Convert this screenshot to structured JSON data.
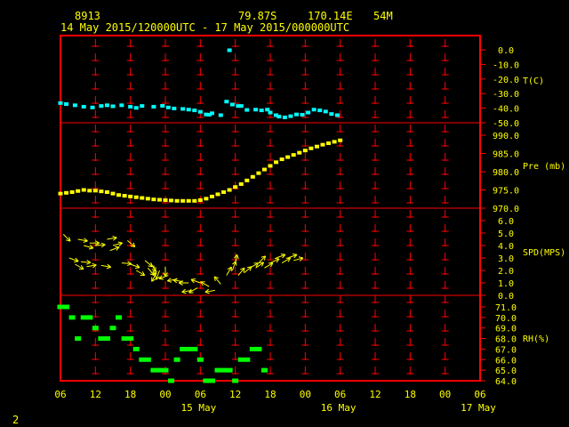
{
  "header": {
    "station_id": "8913",
    "lat": "79.87S",
    "lon": "170.14E",
    "elev": "54M",
    "time_range": "14 May 2015/120000UTC - 17 May 2015/000000UTC"
  },
  "footer": {
    "page_number": "2"
  },
  "colors": {
    "frame": "#ff0000",
    "ticks": "#ff0000",
    "labels": "#ffff00",
    "temperature": "#00ffff",
    "pressure": "#ffff00",
    "wind": "#ffff00",
    "rh": "#00ff00"
  },
  "chart_data": {
    "type": "scatter",
    "x_axis": {
      "range_hours": [
        0,
        72
      ],
      "tick_labels": [
        "06",
        "12",
        "18",
        "00",
        "06",
        "12",
        "18",
        "00",
        "06",
        "12",
        "18",
        "00",
        "06"
      ],
      "day_labels": [
        {
          "label": "15 May",
          "hour": 24
        },
        {
          "label": "16 May",
          "hour": 48
        },
        {
          "label": "17 May",
          "hour": 72
        }
      ]
    },
    "panels": [
      {
        "name": "T(C)",
        "series": "temperature",
        "ylim": [
          -50,
          0
        ],
        "ticks": [
          "0.0",
          "-10.0",
          "-20.0",
          "-30.0",
          "-40.0",
          "-50.0"
        ],
        "points": [
          [
            0.0,
            -36.5
          ],
          [
            1.0,
            -37.2
          ],
          [
            2.5,
            -38.0
          ],
          [
            4.0,
            -39.0
          ],
          [
            5.5,
            -39.5
          ],
          [
            7.0,
            -38.5
          ],
          [
            8.0,
            -38.0
          ],
          [
            9.0,
            -38.7
          ],
          [
            10.5,
            -38.0
          ],
          [
            12.0,
            -39.0
          ],
          [
            13.0,
            -39.8
          ],
          [
            14.0,
            -38.5
          ],
          [
            16.0,
            -39.0
          ],
          [
            17.5,
            -38.4
          ],
          [
            18.5,
            -39.5
          ],
          [
            19.5,
            -40.2
          ],
          [
            21.0,
            -40.5
          ],
          [
            22.0,
            -41.0
          ],
          [
            23.0,
            -41.5
          ],
          [
            24.0,
            -42.5
          ],
          [
            25.0,
            -44.3
          ],
          [
            25.5,
            -44.5
          ],
          [
            26.0,
            -43.5
          ],
          [
            27.5,
            -44.8
          ],
          [
            28.5,
            -35.5
          ],
          [
            29.0,
            -0.3
          ],
          [
            29.5,
            -37.5
          ],
          [
            30.5,
            -38.5
          ],
          [
            31.0,
            -38.5
          ],
          [
            32.0,
            -41.2
          ],
          [
            33.5,
            -41.0
          ],
          [
            34.5,
            -41.5
          ],
          [
            35.5,
            -41.0
          ],
          [
            36.0,
            -43.0
          ],
          [
            37.0,
            -44.8
          ],
          [
            37.5,
            -45.8
          ],
          [
            38.5,
            -46.3
          ],
          [
            39.5,
            -45.5
          ],
          [
            40.5,
            -44.3
          ],
          [
            41.5,
            -44.5
          ],
          [
            42.5,
            -43.0
          ],
          [
            43.5,
            -41.0
          ],
          [
            44.5,
            -41.5
          ],
          [
            45.5,
            -42.3
          ],
          [
            46.5,
            -44.0
          ],
          [
            47.5,
            -44.8
          ]
        ]
      },
      {
        "name": "Pre (mb)",
        "series": "pressure",
        "ylim": [
          970,
          990
        ],
        "ticks": [
          "990.0",
          "985.0",
          "980.0",
          "975.0",
          "970.0"
        ],
        "points": [
          [
            0,
            974.0
          ],
          [
            1,
            974.2
          ],
          [
            2,
            974.4
          ],
          [
            3,
            974.7
          ],
          [
            4,
            975.0
          ],
          [
            5,
            974.8
          ],
          [
            6,
            974.8
          ],
          [
            7,
            974.6
          ],
          [
            8,
            974.4
          ],
          [
            9,
            974.0
          ],
          [
            10,
            973.6
          ],
          [
            11,
            973.4
          ],
          [
            12,
            973.2
          ],
          [
            13,
            973.0
          ],
          [
            14,
            972.8
          ],
          [
            15,
            972.6
          ],
          [
            16,
            972.4
          ],
          [
            17,
            972.3
          ],
          [
            18,
            972.2
          ],
          [
            19,
            972.1
          ],
          [
            20,
            972.0
          ],
          [
            21,
            972.0
          ],
          [
            22,
            972.0
          ],
          [
            23,
            972.0
          ],
          [
            24,
            972.2
          ],
          [
            25,
            972.6
          ],
          [
            26,
            973.2
          ],
          [
            27,
            973.8
          ],
          [
            28,
            974.4
          ],
          [
            29,
            975.0
          ],
          [
            30,
            975.8
          ],
          [
            31,
            976.6
          ],
          [
            32,
            977.6
          ],
          [
            33,
            978.6
          ],
          [
            34,
            979.6
          ],
          [
            35,
            980.6
          ],
          [
            36,
            981.6
          ],
          [
            37,
            982.6
          ],
          [
            38,
            983.4
          ],
          [
            39,
            984.0
          ],
          [
            40,
            984.6
          ],
          [
            41,
            985.2
          ],
          [
            42,
            985.8
          ],
          [
            43,
            986.4
          ],
          [
            44,
            986.9
          ],
          [
            45,
            987.4
          ],
          [
            46,
            987.8
          ],
          [
            47,
            988.2
          ],
          [
            48,
            988.6
          ]
        ]
      },
      {
        "name": "SPD(MPS)",
        "series": "wind",
        "ylim": [
          0,
          6
        ],
        "ticks": [
          "6.0",
          "5.0",
          "4.0",
          "3.0",
          "2.0",
          "1.0",
          "0.0"
        ],
        "points": [
          [
            0.5,
            4.9,
            135
          ],
          [
            1.5,
            3.0,
            110
          ],
          [
            2.5,
            2.5,
            120
          ],
          [
            3.0,
            4.5,
            100
          ],
          [
            3.5,
            2.7,
            95
          ],
          [
            4.0,
            4.0,
            105
          ],
          [
            4.5,
            2.3,
            80
          ],
          [
            5.0,
            4.2,
            90
          ],
          [
            6.0,
            4.0,
            85
          ],
          [
            7.0,
            2.4,
            100
          ],
          [
            8.0,
            4.5,
            80
          ],
          [
            8.5,
            3.6,
            70
          ],
          [
            9.0,
            4.0,
            75
          ],
          [
            10.5,
            2.6,
            95
          ],
          [
            11.5,
            4.4,
            130
          ],
          [
            12.0,
            2.5,
            110
          ],
          [
            13.0,
            2.0,
            120
          ],
          [
            14.5,
            2.8,
            130
          ],
          [
            15.0,
            2.2,
            140
          ],
          [
            15.5,
            2.6,
            150
          ],
          [
            16.0,
            2.4,
            170
          ],
          [
            16.5,
            1.8,
            210
          ],
          [
            17.0,
            2.0,
            200
          ],
          [
            18.0,
            2.3,
            180
          ],
          [
            18.5,
            1.6,
            250
          ],
          [
            20.0,
            1.3,
            260
          ],
          [
            21.0,
            1.1,
            280
          ],
          [
            22.0,
            1.0,
            270
          ],
          [
            22.5,
            0.4,
            260
          ],
          [
            23.5,
            0.6,
            240
          ],
          [
            24.0,
            1.0,
            290
          ],
          [
            25.5,
            0.7,
            300
          ],
          [
            26.5,
            0.4,
            260
          ],
          [
            27.5,
            0.9,
            320
          ],
          [
            28.5,
            1.6,
            30
          ],
          [
            29.5,
            2.0,
            20
          ],
          [
            30.0,
            2.5,
            10
          ],
          [
            30.5,
            1.6,
            40
          ],
          [
            31.5,
            1.8,
            50
          ],
          [
            32.5,
            2.2,
            60
          ],
          [
            33.5,
            2.2,
            55
          ],
          [
            34.0,
            2.6,
            45
          ],
          [
            35.0,
            2.2,
            60
          ],
          [
            36.0,
            2.6,
            65
          ],
          [
            37.0,
            3.0,
            70
          ],
          [
            38.0,
            2.6,
            60
          ],
          [
            39.0,
            3.0,
            70
          ],
          [
            40.0,
            2.8,
            75
          ]
        ]
      },
      {
        "name": "RH(%)",
        "series": "rh",
        "ylim": [
          64,
          71
        ],
        "ticks": [
          "71.0",
          "70.0",
          "69.0",
          "68.0",
          "67.0",
          "66.0",
          "65.0",
          "64.0"
        ],
        "points": [
          [
            0,
            71
          ],
          [
            1,
            71
          ],
          [
            2,
            70
          ],
          [
            3,
            68
          ],
          [
            4,
            70
          ],
          [
            5,
            70
          ],
          [
            6,
            69
          ],
          [
            7,
            68
          ],
          [
            8,
            68
          ],
          [
            9,
            69
          ],
          [
            10,
            70
          ],
          [
            11,
            68
          ],
          [
            12,
            68
          ],
          [
            13,
            67
          ],
          [
            14,
            66
          ],
          [
            15,
            66
          ],
          [
            16,
            65
          ],
          [
            17,
            65
          ],
          [
            18,
            65
          ],
          [
            19,
            64
          ],
          [
            20,
            66
          ],
          [
            21,
            67
          ],
          [
            22,
            67
          ],
          [
            23,
            67
          ],
          [
            24,
            66
          ],
          [
            25,
            64
          ],
          [
            26,
            64
          ],
          [
            27,
            65
          ],
          [
            28,
            65
          ],
          [
            29,
            65
          ],
          [
            30,
            64
          ],
          [
            31,
            66
          ],
          [
            32,
            66
          ],
          [
            33,
            67
          ],
          [
            34,
            67
          ],
          [
            35,
            65
          ]
        ]
      }
    ]
  }
}
